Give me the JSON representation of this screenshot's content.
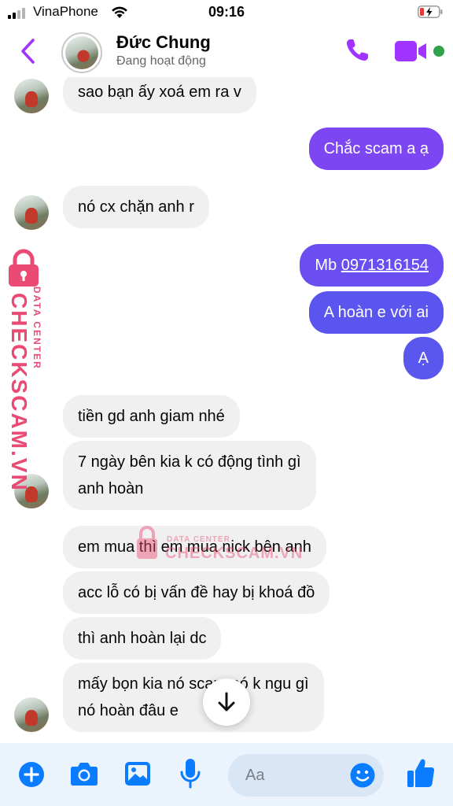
{
  "status_bar": {
    "carrier": "VinaPhone",
    "time": "09:16"
  },
  "header": {
    "contact_name": "Đức Chung",
    "contact_status": "Đang hoạt động"
  },
  "messages": [
    {
      "direction": "in",
      "text": "sao bạn ấy xoá em ra v"
    },
    {
      "direction": "out",
      "text": "Chắc scam a ạ"
    },
    {
      "direction": "in",
      "text": "nó cx chặn anh r"
    },
    {
      "direction": "out",
      "prefix": "Mb ",
      "link": "0971316154"
    },
    {
      "direction": "out",
      "text": "A hoàn e với ai"
    },
    {
      "direction": "out",
      "text": "Ạ"
    },
    {
      "direction": "in",
      "text": "tiền gd anh giam nhé"
    },
    {
      "direction": "in",
      "line1": "7 ngày bên kia k có động tình gì",
      "line2": "anh hoàn"
    },
    {
      "direction": "in",
      "text": "em mua thì em mua nick bên anh"
    },
    {
      "direction": "in",
      "text": "acc lỗ có bị vấn đề hay bị khoá đồ"
    },
    {
      "direction": "in",
      "text": "thì anh hoàn lại dc"
    },
    {
      "direction": "in",
      "line1": "mấy bọn kia nó scam nó k ngu gì",
      "line2": "nó hoàn đâu e"
    }
  ],
  "watermark": {
    "big": "CHECKSCAM.VN",
    "small": "DATA CENTER"
  },
  "composer": {
    "placeholder": "Aa"
  },
  "colors": {
    "accent": "#a033ff",
    "outgoing_bubble": "#6a4ef1",
    "incoming_bubble": "#f0f0f0",
    "composer_bg": "#ebf3fc",
    "icon_blue": "#0a7cff",
    "active_dot": "#31a24c",
    "watermark": "#ea4a73"
  },
  "icons": [
    "back-chevron-icon",
    "phone-icon",
    "video-camera-icon",
    "plus-icon",
    "camera-icon",
    "image-icon",
    "microphone-icon",
    "emoji-icon",
    "thumbs-up-icon",
    "arrow-down-icon",
    "lock-icon"
  ]
}
